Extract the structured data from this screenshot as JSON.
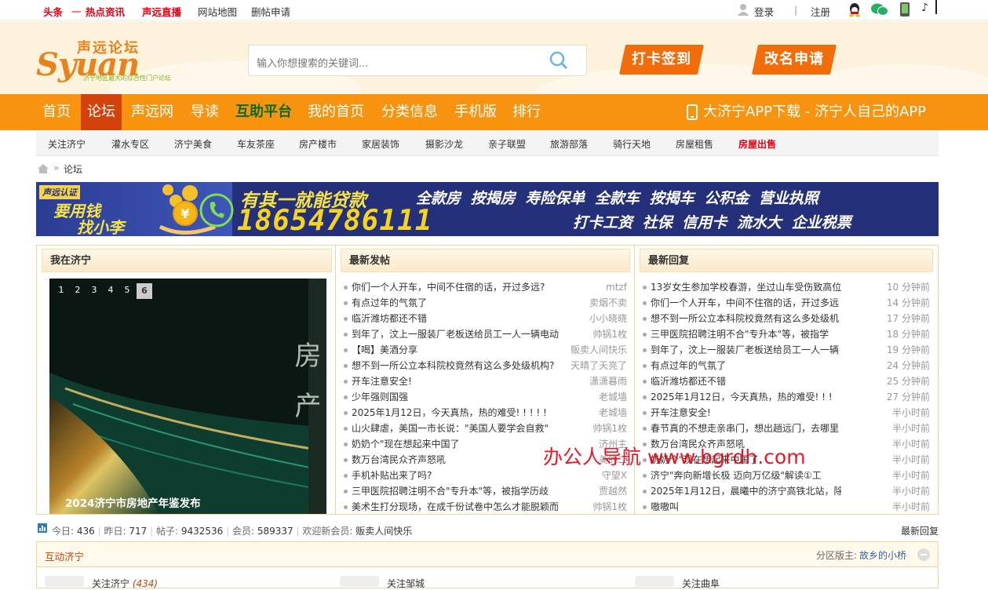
{
  "topbar": {
    "left_links": [
      "头条",
      "一",
      "热点资讯",
      "声远直播",
      "网站地图",
      "删帖申请"
    ],
    "login": "登录",
    "register": "注册"
  },
  "header": {
    "logo_cn": "声远论坛",
    "logo_en": "Syuan",
    ".com": ".COM",
    "logo_slogan": "济宁地区最大的综合性门户论坛",
    "search_placeholder": "输入你想搜索的关键词...",
    "btn_checkin": "打卡签到",
    "btn_rename": "改名申请"
  },
  "nav": {
    "items": [
      "首页",
      "论坛",
      "声远网",
      "导读",
      "互助平台",
      "我的首页",
      "分类信息",
      "手机版",
      "排行"
    ],
    "app": "大济宁APP下载 - 济宁人自己的APP"
  },
  "subnav": [
    "关注济宁",
    "灌水专区",
    "济宁美食",
    "车友茶座",
    "房产楼市",
    "家居装饰",
    "摄影沙龙",
    "亲子联盟",
    "旅游部落",
    "骑行天地",
    "房屋租售",
    "房屋出售"
  ],
  "crumb": {
    "sep": "»",
    "current": "论坛"
  },
  "banner": {
    "tag": "声远认证",
    "line1": "要用钱",
    "line2": "找小李",
    "headline": "有其一就能贷款",
    "phone": "18654786111",
    "items_top": [
      "全款房",
      "按揭房",
      "寿险保单",
      "全款车",
      "按揭车",
      "公积金",
      "营业执照"
    ],
    "items_bottom": [
      "打卡工资",
      "社保",
      "信用卡",
      "流水大",
      "企业税票"
    ]
  },
  "panel1": {
    "title": "我在济宁",
    "slide_nums": [
      "1",
      "2",
      "3",
      "4",
      "5",
      "6"
    ],
    "slide_caption": "2024济宁市房地产年鉴发布",
    "slide_text": "房产"
  },
  "panel2": {
    "title": "最新发帖",
    "rows": [
      {
        "t": "你们一个人开车，中间不住宿的话，开过多远?",
        "a": "mtzf"
      },
      {
        "t": "有点过年的气氛了",
        "a": "卖烟不卖"
      },
      {
        "t": "临沂潍坊都还不错",
        "a": "小小晓晓"
      },
      {
        "t": "到年了，汶上一服装厂老板送给员工一人一辆电动",
        "a": "帅锅1枚"
      },
      {
        "t": "【喝】美酒分享",
        "a": "贩卖人间快乐"
      },
      {
        "t": "想不到一所公立本科院校竟然有这么多处级机构?",
        "a": "天晴了天亮了"
      },
      {
        "t": "开车注意安全!",
        "a": "潇潇暮雨"
      },
      {
        "t": "少年强则国强",
        "a": "老城墙"
      },
      {
        "t": "2025年1月12日，今天真热，热的难受! ! ! ! !",
        "a": "老城墙"
      },
      {
        "t": "山火肆虐，美国一市长说：\"美国人要学会自救\"",
        "a": "帅锅1枚"
      },
      {
        "t": "奶奶个\"现在想起来中国了",
        "a": "济州主"
      },
      {
        "t": "数万台湾民众齐声怒吼",
        "a": "美的二"
      },
      {
        "t": "手机补贴出来了吗?",
        "a": "守望X"
      },
      {
        "t": "三甲医院招聘注明不合\"专升本\"等，被指学历歧",
        "a": "贾越然"
      },
      {
        "t": "美术生打分现场，在成千份试卷中怎么才能脱颖而",
        "a": "帅锅1枚"
      }
    ]
  },
  "panel3": {
    "title": "最新回复",
    "rows": [
      {
        "t": "13岁女生参加学校春游，坐过山车受伤致高位",
        "a": "10 分钟前"
      },
      {
        "t": "你们一个人开车，中间不住宿的话，开过多远",
        "a": "14 分钟前"
      },
      {
        "t": "想不到一所公立本科院校竟然有这么多处级机",
        "a": "17 分钟前"
      },
      {
        "t": "三甲医院招聘注明不合\"专升本\"等，被指学",
        "a": "18 分钟前"
      },
      {
        "t": "到年了，汶上一服装厂老板送给员工一人一辆",
        "a": "19 分钟前"
      },
      {
        "t": "有点过年的气氛了",
        "a": "24 分钟前"
      },
      {
        "t": "临沂潍坊都还不错",
        "a": "25 分钟前"
      },
      {
        "t": "2025年1月12日，今天真热，热的难受! ! !",
        "a": "27 分钟前"
      },
      {
        "t": "开车注意安全!",
        "a": "半小时前"
      },
      {
        "t": "春节真的不想走亲串门，想出趟远门，去哪里",
        "a": "半小时前"
      },
      {
        "t": "数万台湾民众齐声怒吼",
        "a": "半小时前"
      },
      {
        "t": "奶奶个\"现在想起来中国了",
        "a": "半小时前"
      },
      {
        "t": "济宁\"奔向新增长极 迈向万亿级\"解读①工",
        "a": "半小时前"
      },
      {
        "t": "2025年1月12日，晨曦中的济宁高铁北站，除",
        "a": "半小时前"
      },
      {
        "t": "嗷嗷叫",
        "a": "半小时前"
      }
    ]
  },
  "watermark": "办公人导航 www.bgrdh.com",
  "stats": {
    "today_l": "今日:",
    "today": "436",
    "yest_l": "昨日:",
    "yest": "717",
    "posts_l": "帖子:",
    "posts": "9432536",
    "members_l": "会员:",
    "members": "589337",
    "welcome": "欢迎新会员:",
    "newuser": "贩卖人间快乐",
    "latest": "最新回复"
  },
  "section": {
    "title": "互动济宁",
    "mod_label": "分区版主:",
    "mod": "故乡的小桥",
    "forums": [
      {
        "n": "关注济宁",
        "c": "(434)"
      },
      {
        "n": "关注邹城",
        "c": ""
      },
      {
        "n": "关注曲阜",
        "c": ""
      }
    ]
  },
  "colors": {
    "orange": "#f7930e",
    "active": "#d2420a",
    "brand_red": "#e60012",
    "banner_bg": "#24317a"
  }
}
